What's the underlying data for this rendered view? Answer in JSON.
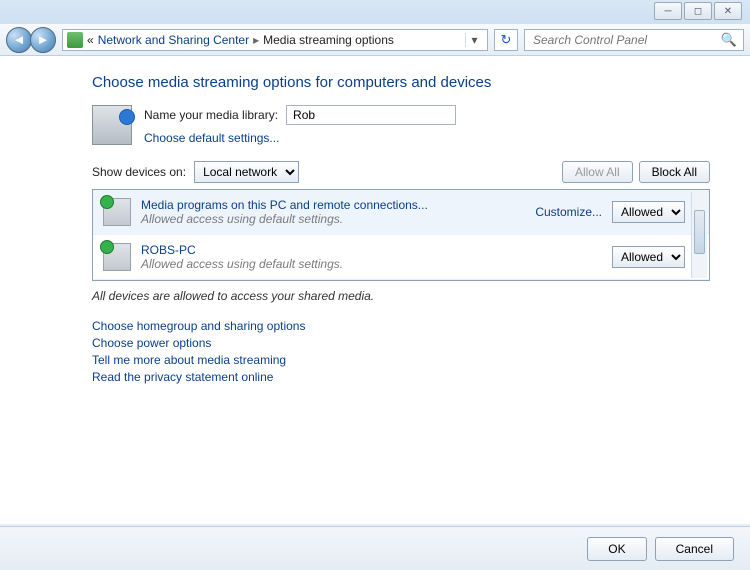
{
  "window": {
    "min_tip": "Minimize",
    "max_tip": "Maximize",
    "close_tip": "Close"
  },
  "toolbar": {
    "breadcrumb": [
      "Network and Sharing Center",
      "Media streaming options"
    ],
    "breadcrumb_prefix": "«",
    "search_placeholder": "Search Control Panel"
  },
  "page": {
    "title": "Choose media streaming options for computers and devices",
    "library_label": "Name your media library:",
    "library_value": "Rob",
    "defaults_link": "Choose default settings...",
    "show_label": "Show devices on:",
    "show_options": [
      "Local network"
    ],
    "allow_all": "Allow All",
    "block_all": "Block All",
    "status_text": "All devices are allowed to access your shared media."
  },
  "devices": [
    {
      "name": "Media programs on this PC and remote connections...",
      "sub": "Allowed access using default settings.",
      "customize": "Customize...",
      "allow_value": "Allowed"
    },
    {
      "name": "ROBS-PC",
      "sub": "Allowed access using default settings.",
      "allow_value": "Allowed"
    }
  ],
  "links": [
    "Choose homegroup and sharing options",
    "Choose power options",
    "Tell me more about media streaming",
    "Read the privacy statement online"
  ],
  "buttons": {
    "ok": "OK",
    "cancel": "Cancel"
  }
}
